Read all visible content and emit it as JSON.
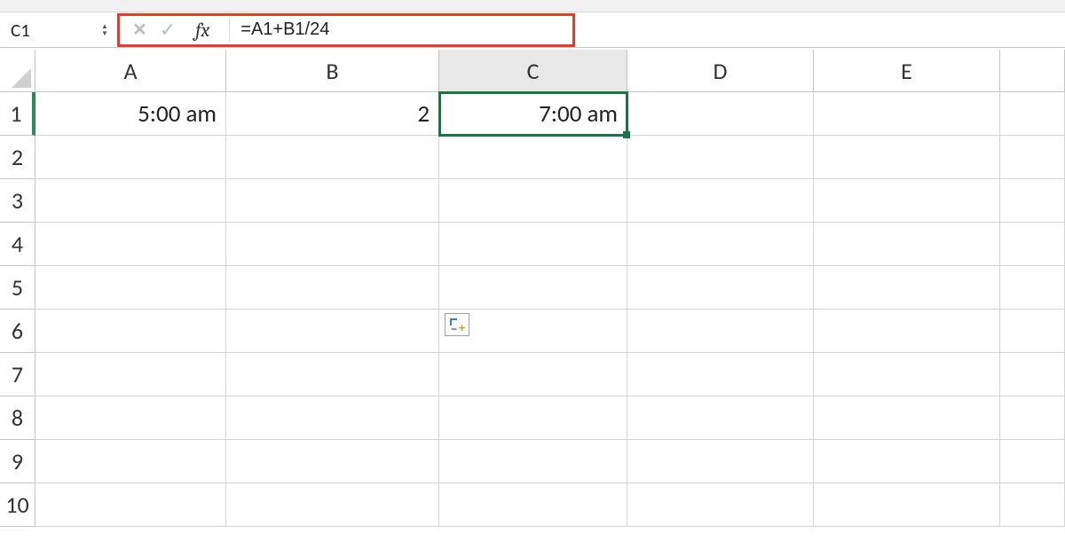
{
  "nameBox": "C1",
  "formula": "=A1+B1/24",
  "fxLabel": "fx",
  "cancelGlyph": "✕",
  "enterGlyph": "✓",
  "columns": [
    "A",
    "B",
    "C",
    "D",
    "E"
  ],
  "activeColumn": "C",
  "rows": [
    "1",
    "2",
    "3",
    "4",
    "5",
    "6",
    "7",
    "8",
    "9",
    "10"
  ],
  "activeRow": "1",
  "cells": {
    "A1": "5:00 am",
    "B1": "2",
    "C1": "7:00 am"
  },
  "selectedCell": "C1"
}
